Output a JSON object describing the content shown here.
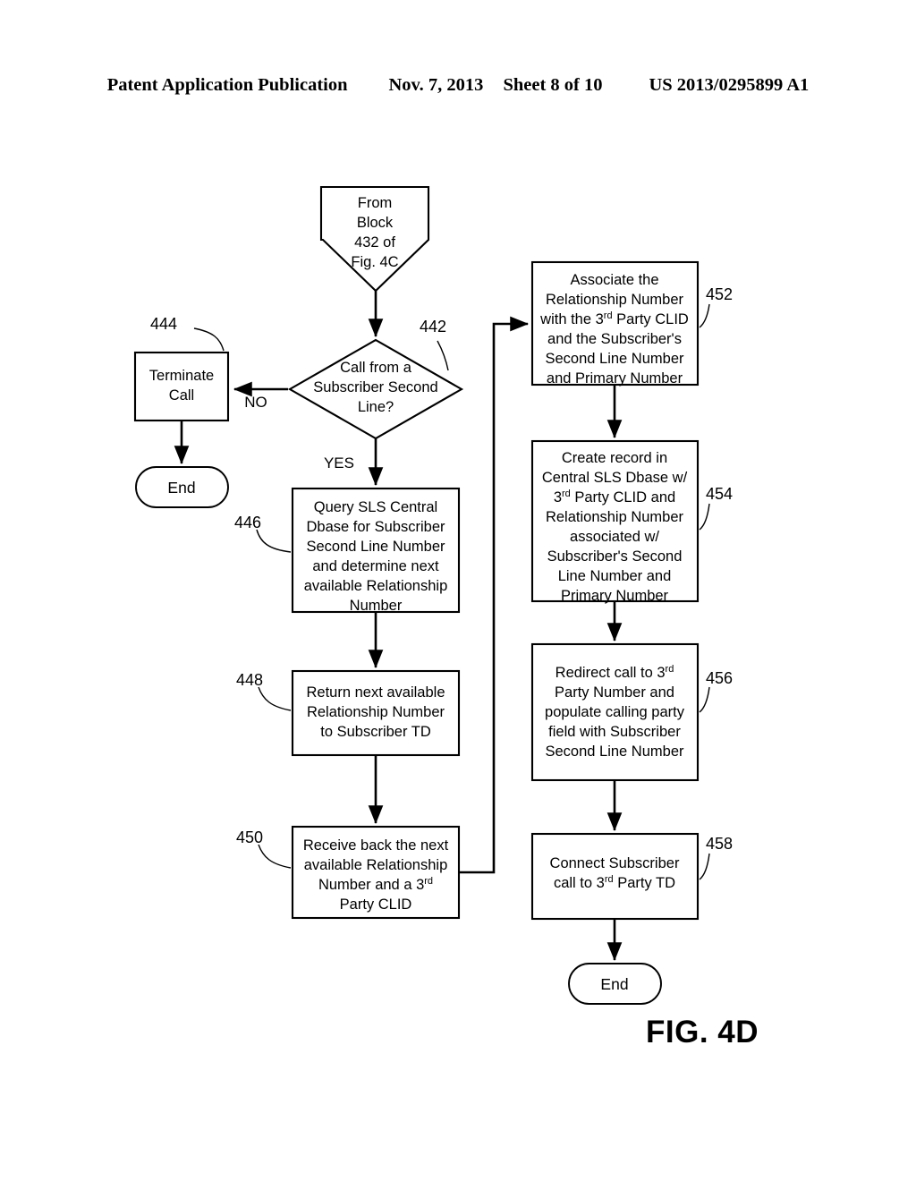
{
  "header": {
    "publication": "Patent Application Publication",
    "date": "Nov. 7, 2013",
    "sheet": "Sheet 8 of 10",
    "number": "US 2013/0295899 A1"
  },
  "figure": {
    "caption": "FIG. 4D",
    "nodes": {
      "entry": {
        "shape": "pentagon",
        "lines": [
          "From",
          "Block",
          "432 of",
          "Fig. 4C"
        ]
      },
      "decision_442": {
        "shape": "diamond",
        "ref": "442",
        "lines": [
          "Call from a",
          "Subscriber Second",
          "Line?"
        ]
      },
      "box_444": {
        "shape": "rectangle",
        "ref": "444",
        "lines": [
          "Terminate",
          "Call"
        ]
      },
      "end_left": {
        "shape": "terminator",
        "label": "End"
      },
      "box_446": {
        "shape": "rectangle",
        "ref": "446",
        "lines": [
          "Query SLS Central",
          "Dbase for Subscriber",
          "Second Line Number",
          "and determine next",
          "available Relationship",
          "Number"
        ]
      },
      "box_448": {
        "shape": "rectangle",
        "ref": "448",
        "lines": [
          "Return next available",
          "Relationship Number",
          "to Subscriber TD"
        ]
      },
      "box_450": {
        "shape": "rectangle",
        "ref": "450",
        "lines": [
          "Receive back the next",
          "available Relationship",
          "Number and a 3rd",
          "Party CLID"
        ],
        "line3_pre": "Number and a 3",
        "line3_sup": "rd"
      },
      "box_452": {
        "shape": "rectangle",
        "ref": "452",
        "lines": [
          "Associate the",
          "Relationship Number",
          "with the 3rd Party CLID",
          "and the Subscriber's",
          "Second Line Number",
          "and Primary Number"
        ],
        "line3_pre": "with the 3",
        "line3_sup": "rd",
        "line3_post": " Party CLID"
      },
      "box_454": {
        "shape": "rectangle",
        "ref": "454",
        "lines": [
          "Create record in",
          "Central SLS Dbase w/",
          "3rd Party CLID and",
          "Relationship Number",
          "associated w/",
          "Subscriber's Second",
          "Line Number and",
          "Primary Number"
        ],
        "line3_pre": "3",
        "line3_sup": "rd",
        "line3_post": " Party CLID and"
      },
      "box_456": {
        "shape": "rectangle",
        "ref": "456",
        "lines": [
          "Redirect call to 3rd",
          "Party Number and",
          "populate calling party",
          "field with Subscriber",
          "Second Line Number"
        ],
        "line1_pre": "Redirect call to 3",
        "line1_sup": "rd"
      },
      "box_458": {
        "shape": "rectangle",
        "ref": "458",
        "lines": [
          "Connect Subscriber",
          "call to 3rd Party TD"
        ],
        "line2_pre": "call to 3",
        "line2_sup": "rd",
        "line2_post": " Party TD"
      },
      "end_right": {
        "shape": "terminator",
        "label": "End"
      }
    },
    "edge_labels": {
      "no": "NO",
      "yes": "YES"
    }
  },
  "colors": {
    "ink": "#000000",
    "paper": "#ffffff"
  }
}
